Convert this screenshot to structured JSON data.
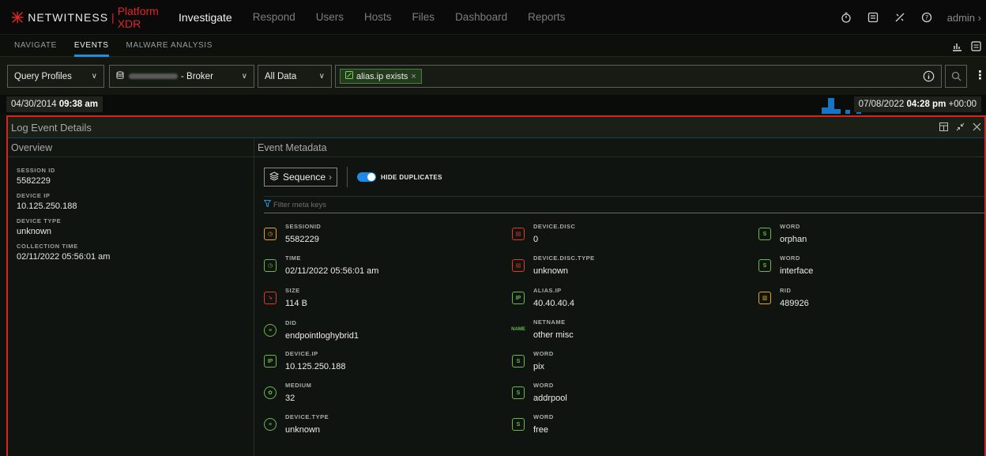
{
  "brand": {
    "name": "NETWITNESS",
    "product": "Platform XDR",
    "accent": "#e02626"
  },
  "topnav": [
    "Investigate",
    "Respond",
    "Users",
    "Hosts",
    "Files",
    "Dashboard",
    "Reports"
  ],
  "user": "admin",
  "subnav": [
    "NAVIGATE",
    "EVENTS",
    "MALWARE ANALYSIS"
  ],
  "query": {
    "profiles": "Query Profiles",
    "service": "- Broker",
    "data_scope": "All Data",
    "filter_pill": "alias.ip exists",
    "pill_close": "×"
  },
  "time": {
    "start_date": "04/30/2014",
    "start_time": "09:38 am",
    "end_date": "07/08/2022",
    "end_time": "04:28 pm",
    "end_tz": "+00:00"
  },
  "panel": {
    "title": "Log Event Details",
    "overview_title": "Overview",
    "metadata_title": "Event Metadata",
    "sequence_label": "Sequence",
    "hide_dup_label": "HIDE DUPLICATES",
    "filter_placeholder": "Filter meta keys"
  },
  "overview": [
    {
      "label": "SESSION ID",
      "value": "5582229"
    },
    {
      "label": "DEVICE IP",
      "value": "10.125.250.188"
    },
    {
      "label": "DEVICE TYPE",
      "value": "unknown"
    },
    {
      "label": "COLLECTION TIME",
      "value": "02/11/2022 05:56:01 am"
    }
  ],
  "metadata": {
    "col1": [
      {
        "key": "SESSIONID",
        "value": "5582229",
        "icon": "session-icon"
      },
      {
        "key": "TIME",
        "value": "02/11/2022 05:56:01 am",
        "icon": "clock-icon"
      },
      {
        "key": "SIZE",
        "value": "114 B",
        "icon": "size-icon"
      },
      {
        "key": "DID",
        "value": "endpointloghybrid1",
        "icon": "database-icon"
      },
      {
        "key": "DEVICE.IP",
        "value": "10.125.250.188",
        "icon": "ip-icon"
      },
      {
        "key": "MEDIUM",
        "value": "32",
        "icon": "medium-icon"
      },
      {
        "key": "DEVICE.TYPE",
        "value": "unknown",
        "icon": "database-icon"
      }
    ],
    "col2": [
      {
        "key": "DEVICE.DISC",
        "value": "0",
        "icon": "device-disc-icon"
      },
      {
        "key": "DEVICE.DISC.TYPE",
        "value": "unknown",
        "icon": "device-disc-icon"
      },
      {
        "key": "ALIAS.IP",
        "value": "40.40.40.4",
        "icon": "ip-icon"
      },
      {
        "key": "NETNAME",
        "value": "other misc",
        "icon": "name-icon"
      },
      {
        "key": "WORD",
        "value": "pix",
        "icon": "word-icon"
      },
      {
        "key": "WORD",
        "value": "addrpool",
        "icon": "word-icon"
      },
      {
        "key": "WORD",
        "value": "free",
        "icon": "word-icon"
      }
    ],
    "col3": [
      {
        "key": "WORD",
        "value": "orphan",
        "icon": "word-icon"
      },
      {
        "key": "WORD",
        "value": "interface",
        "icon": "word-icon"
      },
      {
        "key": "RID",
        "value": "489926",
        "icon": "rid-icon"
      }
    ]
  }
}
